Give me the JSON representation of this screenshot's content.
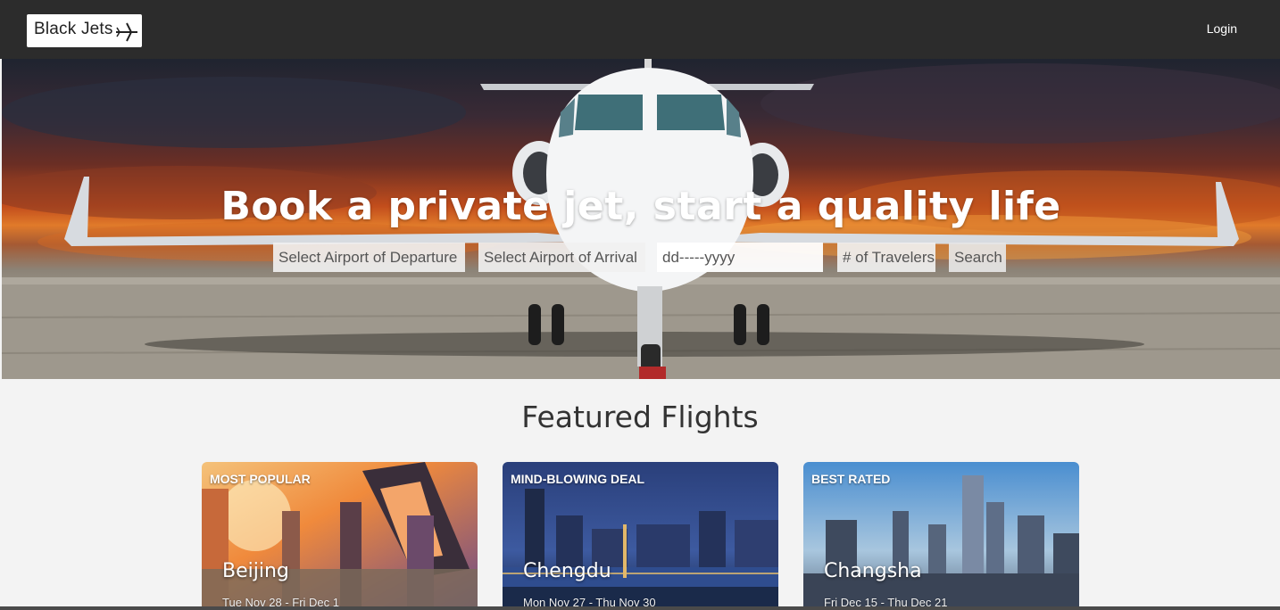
{
  "navbar": {
    "logo_text": "Black Jets",
    "login_label": "Login"
  },
  "hero": {
    "title": "Book a private jet, start a quality life",
    "search": {
      "departure_placeholder": "Select Airport of Departure",
      "arrival_placeholder": "Select Airport of Arrival",
      "date_placeholder": "dd-----yyyy",
      "travelers_placeholder": "# of Travelers",
      "search_label": "Search"
    }
  },
  "featured": {
    "title": "Featured Flights",
    "cards": [
      {
        "badge": "MOST POPULAR",
        "city": "Beijing",
        "dates": "Tue Nov 28 - Fri Dec 1"
      },
      {
        "badge": "MIND-BLOWING DEAL",
        "city": "Chengdu",
        "dates": "Mon Nov 27 - Thu Nov 30"
      },
      {
        "badge": "BEST RATED",
        "city": "Changsha",
        "dates": "Fri Dec 15 - Thu Dec 21"
      }
    ]
  },
  "colors": {
    "navbar_bg": "#2c2c2c",
    "page_bg": "#f3f3f3",
    "title_text": "#ffffff"
  }
}
